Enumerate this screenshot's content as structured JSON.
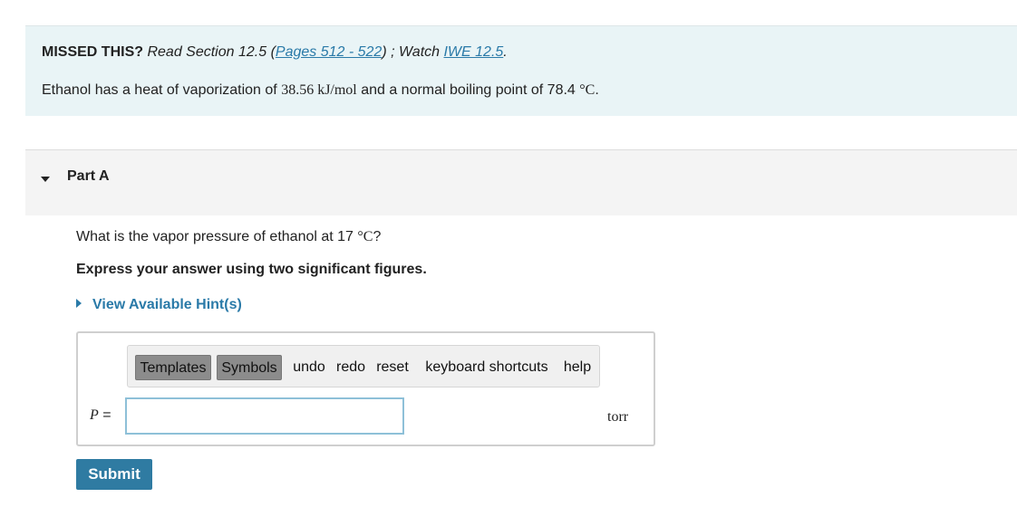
{
  "intro": {
    "missed_lead": "MISSED THIS?",
    "read_text": "Read Section 12.5 (",
    "pages_link": "Pages 512 - 522",
    "after_pages": ") ; Watch ",
    "iwe_link": "IWE 12.5",
    "end": ".",
    "problem_prefix": "Ethanol has a heat of vaporization of ",
    "heat_value": "38.56 kJ/mol",
    "problem_mid": " and a normal boiling point of 78.4 ",
    "temp_unit": "°C",
    "problem_end": "."
  },
  "part": {
    "title": "Part A"
  },
  "question": {
    "prefix": "What is the vapor pressure of ethanol at 17 ",
    "unit": "°C",
    "suffix": "?",
    "instruction": "Express your answer using two significant figures.",
    "hints_label": "View Available Hint(s)"
  },
  "toolbar": {
    "templates": "Templates",
    "symbols": "Symbols",
    "undo": "undo",
    "redo": "redo",
    "reset": "reset",
    "keyboard_shortcuts": "keyboard shortcuts",
    "help": "help"
  },
  "answer": {
    "variable": "P",
    "equals": " =",
    "value": "",
    "unit": "torr"
  },
  "submit_label": "Submit"
}
